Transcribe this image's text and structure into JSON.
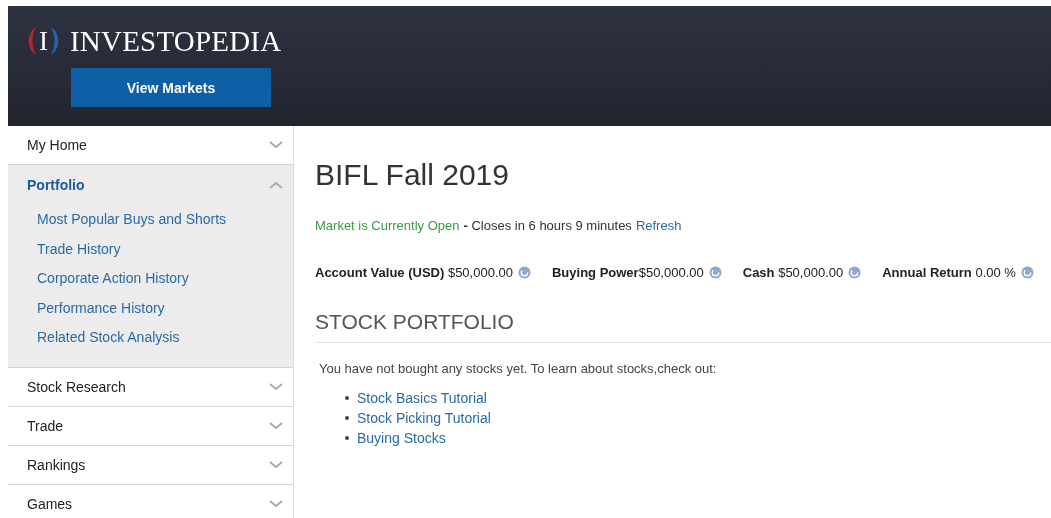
{
  "header": {
    "logo_mark": "I",
    "logo_text": "INVESTOPEDIA",
    "button": "View Markets"
  },
  "sidebar": {
    "items": [
      {
        "label": "My Home",
        "expanded": false
      },
      {
        "label": "Portfolio",
        "expanded": true,
        "children": [
          "Most Popular Buys and Shorts",
          "Trade History",
          "Corporate Action History",
          "Performance History",
          "Related Stock Analysis"
        ]
      },
      {
        "label": "Stock Research",
        "expanded": false
      },
      {
        "label": "Trade",
        "expanded": false
      },
      {
        "label": "Rankings",
        "expanded": false
      },
      {
        "label": "Games",
        "expanded": false
      }
    ]
  },
  "main": {
    "title": "BIFL Fall 2019",
    "market": {
      "status": "Market is Currently Open",
      "detail": "**-** Closes in 6 hours 9 minutes",
      "refresh": "Refresh"
    },
    "stats": [
      "**Account Value (USD)** $50,000.00",
      "**Buying Power**$50,000.00",
      "**Cash** $50,000.00",
      "**Annual Return** 0.00 %"
    ],
    "section_title": "STOCK PORTFOLIO",
    "message": "You have not bought any stocks yet. To learn about stocks,check out:",
    "links": [
      "Stock Basics Tutorial",
      "Stock Picking Tutorial",
      "Buying Stocks"
    ]
  }
}
